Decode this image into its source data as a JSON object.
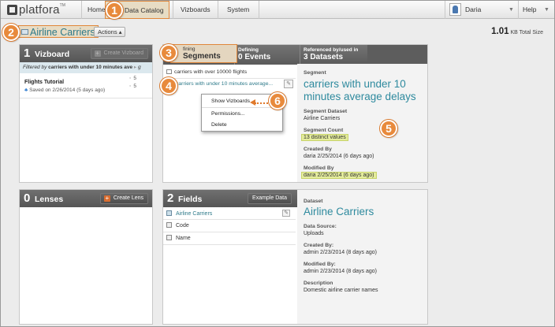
{
  "nav": {
    "logo": "platfora",
    "logo_tm": "TM",
    "home": "Home",
    "data_catalog": "Data Catalog",
    "vizboards": "Vizboards",
    "system": "System",
    "user": "Daria",
    "help": "Help"
  },
  "dataset": {
    "name": "Airline Carriers",
    "actions": "Actions",
    "total_size_value": "1.01",
    "total_size_unit": "KB Total Size"
  },
  "vizboard_panel": {
    "count": "1",
    "label": "Vizboard",
    "create_button": "Create Vizboard",
    "filter_prefix": "Filtered by",
    "filter_value": "carriers with under 10 minutes ave",
    "filter_suffix": "g",
    "item_title": "Flights Tutorial",
    "item_saved": "Saved on 2/26/2014 (5 days ago)",
    "item_count_a": "5",
    "item_count_b": "5"
  },
  "segments_panel": {
    "tab_segments_top": "fining",
    "tab_segments_bottom": "Segments",
    "tab_defining_top": "Defining",
    "tab_defining_bottom": "0 Events",
    "tab_referenced_top": "Referenced by/used in",
    "tab_referenced_bottom": "3 Datasets",
    "segment_1": "carriers with over 10000 flights",
    "segment_2": "carriers with under 10 minutes average...",
    "menu": [
      "Show Vizboards",
      "Permissions...",
      "Delete"
    ]
  },
  "segment_detail": {
    "segment_label": "Segment",
    "segment_title": "carriers with under 10 minutes average delays",
    "dataset_label": "Segment Dataset",
    "dataset_value": "Airline Carriers",
    "count_label": "Segment Count",
    "count_value": "13 distinct values",
    "created_label": "Created By",
    "created_value": "daria 2/25/2014 (6 days ago)",
    "modified_label": "Modified By",
    "modified_value": "daria 2/25/2014 (6 days ago)"
  },
  "lenses_panel": {
    "count": "0",
    "label": "Lenses",
    "create_button": "Create Lens"
  },
  "fields_panel": {
    "count": "2",
    "label": "Fields",
    "example_button": "Example Data",
    "rows": [
      "Airline Carriers",
      "Code",
      "Name"
    ]
  },
  "dataset_detail": {
    "dataset_label": "Dataset",
    "dataset_title": "Airline Carriers",
    "source_label": "Data Source:",
    "source_value": "Uploads",
    "created_label": "Created By:",
    "created_value": "admin 2/23/2014 (8 days ago)",
    "modified_label": "Modified By:",
    "modified_value": "admin 2/23/2014 (8 days ago)",
    "description_label": "Description",
    "description_value": "Domestic airline carrier names"
  },
  "markers": [
    "1",
    "2",
    "3",
    "4",
    "5",
    "6"
  ],
  "colors": {
    "accent_orange": "#e88a3c",
    "link_teal": "#2e7a8a",
    "highlight": "#e4ec9c"
  }
}
